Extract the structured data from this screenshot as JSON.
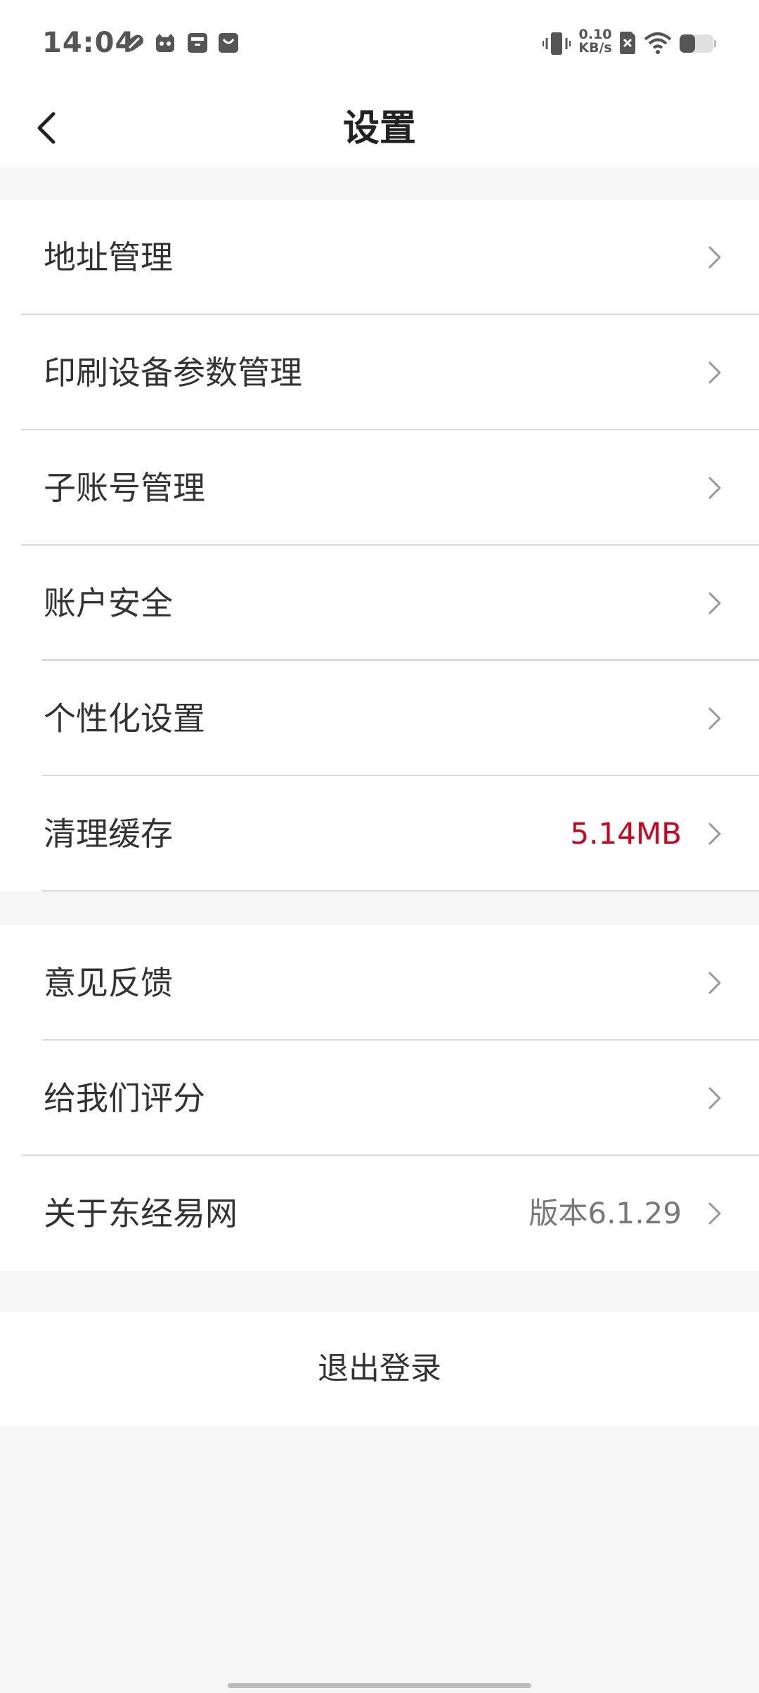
{
  "status_bar": {
    "time": "14:04",
    "net_speed_value": "0.10",
    "net_speed_unit": "KB/s",
    "icons": [
      "pill-app-icon",
      "cat-face-icon",
      "storage-box-icon",
      "shopping-bag-icon",
      "vibrate-icon",
      "no-sim-icon",
      "wifi-icon",
      "battery-icon"
    ]
  },
  "header": {
    "title": "设置",
    "back_icon": "chevron-left-icon"
  },
  "groups": [
    {
      "items": [
        {
          "label": "地址管理",
          "value": ""
        },
        {
          "label": "印刷设备参数管理",
          "value": ""
        },
        {
          "label": "子账号管理",
          "value": ""
        },
        {
          "label": "账户安全",
          "value": ""
        },
        {
          "label": "个性化设置",
          "value": ""
        },
        {
          "label": "清理缓存",
          "value": "5.14MB"
        }
      ]
    },
    {
      "items": [
        {
          "label": "意见反馈",
          "value": ""
        },
        {
          "label": "给我们评分",
          "value": ""
        },
        {
          "label": "关于东经易网",
          "value": "版本6.1.29"
        }
      ]
    }
  ],
  "logout_label": "退出登录",
  "colors": {
    "accent_red": "#d0021b",
    "background": "#f6f6f6",
    "card": "#ffffff"
  }
}
